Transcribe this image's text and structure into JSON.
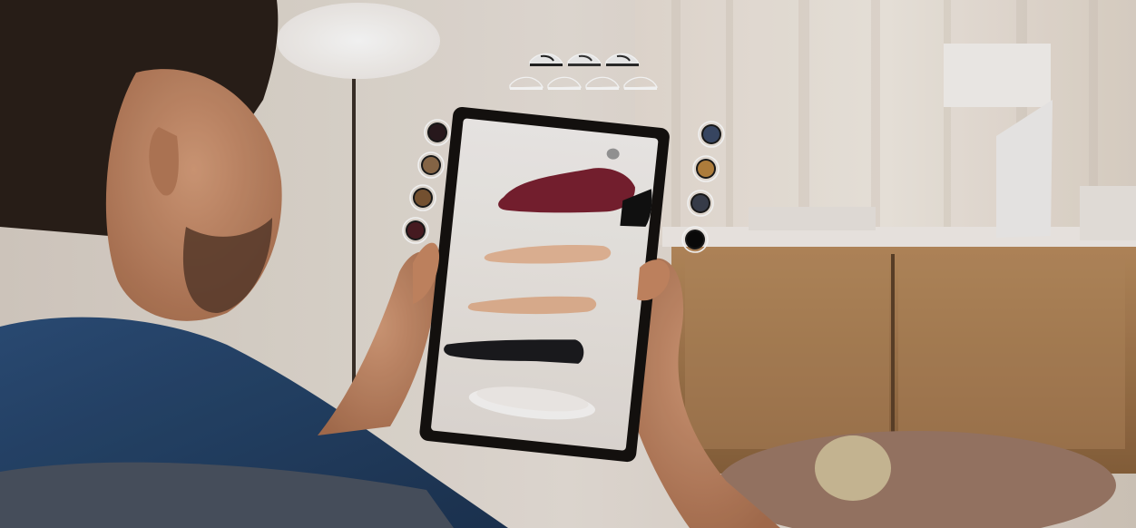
{
  "scene": {
    "kind": "photo",
    "colors": {
      "wall": "#e7dfd6",
      "curtain": "#efe6dc",
      "cabinet": "#a57a4f",
      "skin": "#c8906a",
      "shirt": "#2b4b72",
      "tablet_frame": "#15110f",
      "tablet_screen": "#efeae6",
      "shoe_upper": "#7a2030",
      "insole": "#e8bda0",
      "sole": "#1f1f22"
    }
  },
  "shoe_styles": {
    "top_row": [
      {
        "icon": "oxford-shoe-icon",
        "tone": "#222"
      },
      {
        "icon": "brogue-shoe-icon",
        "tone": "#333"
      },
      {
        "icon": "derby-shoe-icon",
        "tone": "#2b2b2b"
      }
    ],
    "bottom_row": [
      {
        "icon": "loafer-outline-icon",
        "tone": "#ffffff"
      },
      {
        "icon": "oxford-outline-icon",
        "tone": "#ffffff"
      },
      {
        "icon": "monk-outline-icon",
        "tone": "#ffffff"
      },
      {
        "icon": "slipon-outline-icon",
        "tone": "#ffffff"
      }
    ]
  },
  "swatches": {
    "left": [
      {
        "color": "#2a1a1e",
        "icon": "color-swatch-dark-brown"
      },
      {
        "color": "#8d6b4a",
        "icon": "color-swatch-tan"
      },
      {
        "color": "#7b5634",
        "icon": "color-swatch-brown"
      },
      {
        "color": "#4a1c22",
        "icon": "color-swatch-burgundy"
      }
    ],
    "right": [
      {
        "color": "#3b4a66",
        "icon": "color-swatch-navy"
      },
      {
        "color": "#b8843f",
        "icon": "color-swatch-cognac"
      },
      {
        "color": "#3a3f4d",
        "icon": "color-swatch-slate"
      },
      {
        "color": "#0a0a0a",
        "icon": "color-swatch-black"
      }
    ]
  },
  "tablet": {
    "layers": [
      {
        "name": "shoe-upper",
        "color": "#7a2030"
      },
      {
        "name": "heel-cap",
        "color": "#111111"
      },
      {
        "name": "insole-top",
        "color": "#e7b898"
      },
      {
        "name": "insole-bottom",
        "color": "#e4b493"
      },
      {
        "name": "outsole",
        "color": "#1b1b1e"
      }
    ]
  }
}
